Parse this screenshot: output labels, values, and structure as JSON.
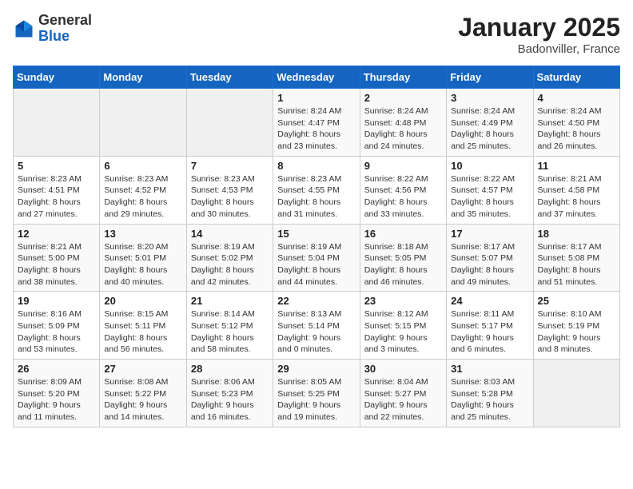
{
  "header": {
    "logo_general": "General",
    "logo_blue": "Blue",
    "month_title": "January 2025",
    "location": "Badonviller, France"
  },
  "weekdays": [
    "Sunday",
    "Monday",
    "Tuesday",
    "Wednesday",
    "Thursday",
    "Friday",
    "Saturday"
  ],
  "weeks": [
    [
      {
        "day": "",
        "info": ""
      },
      {
        "day": "",
        "info": ""
      },
      {
        "day": "",
        "info": ""
      },
      {
        "day": "1",
        "info": "Sunrise: 8:24 AM\nSunset: 4:47 PM\nDaylight: 8 hours\nand 23 minutes."
      },
      {
        "day": "2",
        "info": "Sunrise: 8:24 AM\nSunset: 4:48 PM\nDaylight: 8 hours\nand 24 minutes."
      },
      {
        "day": "3",
        "info": "Sunrise: 8:24 AM\nSunset: 4:49 PM\nDaylight: 8 hours\nand 25 minutes."
      },
      {
        "day": "4",
        "info": "Sunrise: 8:24 AM\nSunset: 4:50 PM\nDaylight: 8 hours\nand 26 minutes."
      }
    ],
    [
      {
        "day": "5",
        "info": "Sunrise: 8:23 AM\nSunset: 4:51 PM\nDaylight: 8 hours\nand 27 minutes."
      },
      {
        "day": "6",
        "info": "Sunrise: 8:23 AM\nSunset: 4:52 PM\nDaylight: 8 hours\nand 29 minutes."
      },
      {
        "day": "7",
        "info": "Sunrise: 8:23 AM\nSunset: 4:53 PM\nDaylight: 8 hours\nand 30 minutes."
      },
      {
        "day": "8",
        "info": "Sunrise: 8:23 AM\nSunset: 4:55 PM\nDaylight: 8 hours\nand 31 minutes."
      },
      {
        "day": "9",
        "info": "Sunrise: 8:22 AM\nSunset: 4:56 PM\nDaylight: 8 hours\nand 33 minutes."
      },
      {
        "day": "10",
        "info": "Sunrise: 8:22 AM\nSunset: 4:57 PM\nDaylight: 8 hours\nand 35 minutes."
      },
      {
        "day": "11",
        "info": "Sunrise: 8:21 AM\nSunset: 4:58 PM\nDaylight: 8 hours\nand 37 minutes."
      }
    ],
    [
      {
        "day": "12",
        "info": "Sunrise: 8:21 AM\nSunset: 5:00 PM\nDaylight: 8 hours\nand 38 minutes."
      },
      {
        "day": "13",
        "info": "Sunrise: 8:20 AM\nSunset: 5:01 PM\nDaylight: 8 hours\nand 40 minutes."
      },
      {
        "day": "14",
        "info": "Sunrise: 8:19 AM\nSunset: 5:02 PM\nDaylight: 8 hours\nand 42 minutes."
      },
      {
        "day": "15",
        "info": "Sunrise: 8:19 AM\nSunset: 5:04 PM\nDaylight: 8 hours\nand 44 minutes."
      },
      {
        "day": "16",
        "info": "Sunrise: 8:18 AM\nSunset: 5:05 PM\nDaylight: 8 hours\nand 46 minutes."
      },
      {
        "day": "17",
        "info": "Sunrise: 8:17 AM\nSunset: 5:07 PM\nDaylight: 8 hours\nand 49 minutes."
      },
      {
        "day": "18",
        "info": "Sunrise: 8:17 AM\nSunset: 5:08 PM\nDaylight: 8 hours\nand 51 minutes."
      }
    ],
    [
      {
        "day": "19",
        "info": "Sunrise: 8:16 AM\nSunset: 5:09 PM\nDaylight: 8 hours\nand 53 minutes."
      },
      {
        "day": "20",
        "info": "Sunrise: 8:15 AM\nSunset: 5:11 PM\nDaylight: 8 hours\nand 56 minutes."
      },
      {
        "day": "21",
        "info": "Sunrise: 8:14 AM\nSunset: 5:12 PM\nDaylight: 8 hours\nand 58 minutes."
      },
      {
        "day": "22",
        "info": "Sunrise: 8:13 AM\nSunset: 5:14 PM\nDaylight: 9 hours\nand 0 minutes."
      },
      {
        "day": "23",
        "info": "Sunrise: 8:12 AM\nSunset: 5:15 PM\nDaylight: 9 hours\nand 3 minutes."
      },
      {
        "day": "24",
        "info": "Sunrise: 8:11 AM\nSunset: 5:17 PM\nDaylight: 9 hours\nand 6 minutes."
      },
      {
        "day": "25",
        "info": "Sunrise: 8:10 AM\nSunset: 5:19 PM\nDaylight: 9 hours\nand 8 minutes."
      }
    ],
    [
      {
        "day": "26",
        "info": "Sunrise: 8:09 AM\nSunset: 5:20 PM\nDaylight: 9 hours\nand 11 minutes."
      },
      {
        "day": "27",
        "info": "Sunrise: 8:08 AM\nSunset: 5:22 PM\nDaylight: 9 hours\nand 14 minutes."
      },
      {
        "day": "28",
        "info": "Sunrise: 8:06 AM\nSunset: 5:23 PM\nDaylight: 9 hours\nand 16 minutes."
      },
      {
        "day": "29",
        "info": "Sunrise: 8:05 AM\nSunset: 5:25 PM\nDaylight: 9 hours\nand 19 minutes."
      },
      {
        "day": "30",
        "info": "Sunrise: 8:04 AM\nSunset: 5:27 PM\nDaylight: 9 hours\nand 22 minutes."
      },
      {
        "day": "31",
        "info": "Sunrise: 8:03 AM\nSunset: 5:28 PM\nDaylight: 9 hours\nand 25 minutes."
      },
      {
        "day": "",
        "info": ""
      }
    ]
  ]
}
